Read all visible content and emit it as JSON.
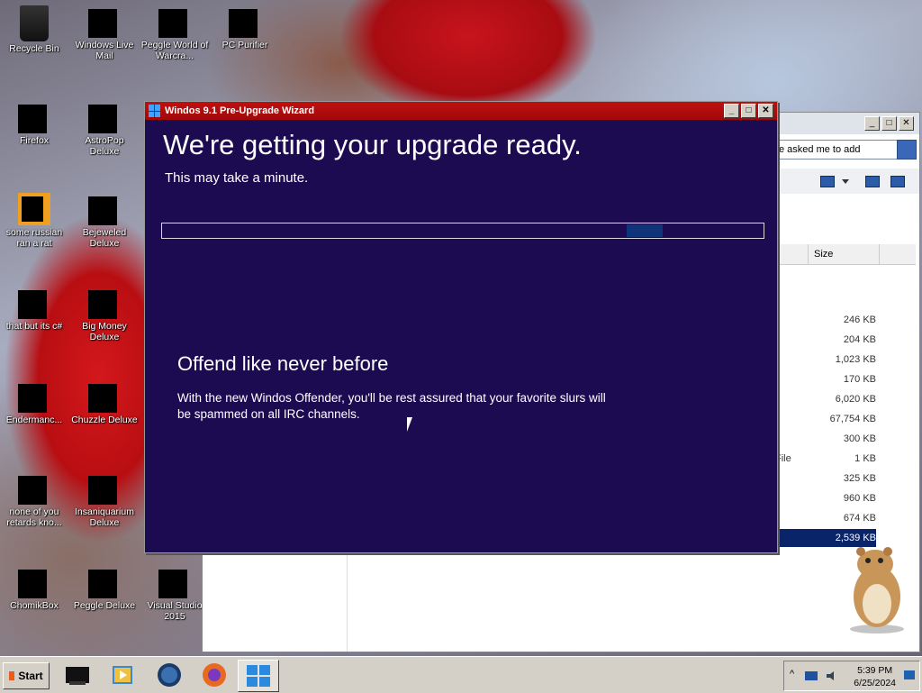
{
  "desktop": {
    "icons": [
      {
        "label": "Recycle Bin"
      },
      {
        "label": "Windows Live Mail"
      },
      {
        "label": "Peggle World of Warcra..."
      },
      {
        "label": "PC Purifier"
      },
      {
        "label": "Firefox"
      },
      {
        "label": "AstroPop Deluxe"
      },
      {
        "label": "some russian ran a rat"
      },
      {
        "label": "Bejeweled Deluxe"
      },
      {
        "label": "that but its c#"
      },
      {
        "label": "Big Money Deluxe"
      },
      {
        "label": "Endermanc..."
      },
      {
        "label": "Chuzzle Deluxe"
      },
      {
        "label": "none of you retards kno..."
      },
      {
        "label": "Insaniquarium Deluxe"
      },
      {
        "label": "ChomikBox"
      },
      {
        "label": "Peggle Deluxe"
      },
      {
        "label": "Visual Studio 2015"
      }
    ]
  },
  "wizard": {
    "title": "Windos 9.1 Pre-Upgrade Wizard",
    "heading": "We're getting your upgrade ready.",
    "subheading": "This may take a minute.",
    "progress_fraction": 0.06,
    "feature_title": "Offend like never before",
    "feature_body": "With the new Windos Offender, you'll be rest assured that your favorite slurs will be spammed on all IRC channels.",
    "colors": {
      "background": "#1d0b52",
      "titlebar": "#b00c0c",
      "progress_fill": "#10347a"
    }
  },
  "explorer": {
    "search_placeholder": "e asked me to add",
    "size_column_header": "Size",
    "type_fragment": "File",
    "sizes": [
      "246 KB",
      "204 KB",
      "1,023 KB",
      "170 KB",
      "6,020 KB",
      "67,754 KB",
      "300 KB",
      "1 KB",
      "325 KB",
      "960 KB",
      "674 KB",
      "2,539 KB"
    ],
    "selected_size": "2,539 KB"
  },
  "taskbar": {
    "start_label": "Start",
    "apps": [
      "terminal-icon",
      "media-player-icon",
      "globe-icon",
      "firefox-icon",
      "windows-icon"
    ],
    "time": "5:39 PM",
    "date": "6/25/2024"
  }
}
